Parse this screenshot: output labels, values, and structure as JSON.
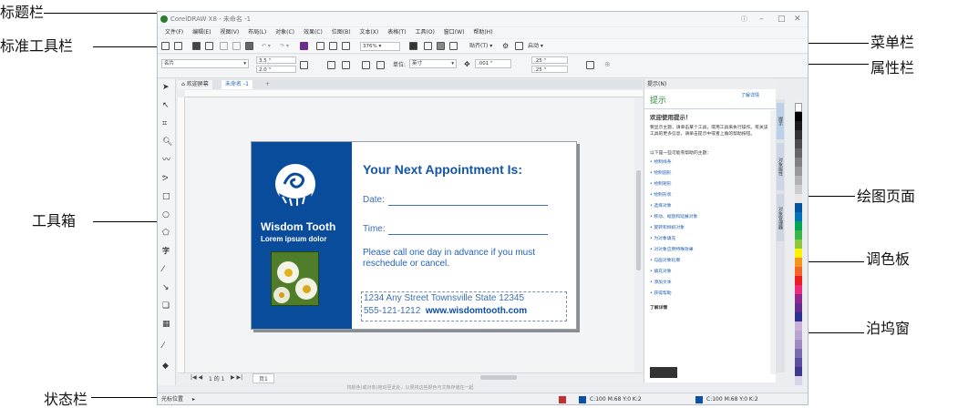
{
  "callouts": {
    "title_bar": "标题栏",
    "standard_toolbar": "标准工具栏",
    "toolbox": "工具箱",
    "status_bar": "状态栏",
    "menu_bar": "菜单栏",
    "property_bar": "属性栏",
    "drawing_page": "绘图页面",
    "color_palette": "调色板",
    "docker": "泊坞窗"
  },
  "window": {
    "title": "CorelDRAW X8 - 未命名 -1",
    "minimize": "–",
    "restore": "□",
    "close": "✕"
  },
  "menu": [
    "文件(F)",
    "编辑(E)",
    "视图(V)",
    "布局(L)",
    "对象(C)",
    "效果(C)",
    "位图(B)",
    "文本(X)",
    "表格(T)",
    "工具(O)",
    "窗口(W)",
    "帮助(H)"
  ],
  "standard_toolbar": {
    "zoom": "376%",
    "snap": "贴齐(T)",
    "launch": "启动"
  },
  "property_bar": {
    "paper": "名片",
    "width": "3.5 \"",
    "height": "2.0 \"",
    "units_label": "单位:",
    "units": "英寸",
    "nudge": ".001 \"",
    "dup_x": ".25 \"",
    "dup_y": ".25 \""
  },
  "doc_tabs": {
    "welcome": "欢迎屏幕",
    "doc": "未命名 -1",
    "add": "+"
  },
  "card": {
    "company": "Wisdom Tooth",
    "tagline": "Lorem ipsum dolor",
    "heading": "Your Next Appointment Is:",
    "date_label": "Date:",
    "time_label": "Time:",
    "message": "Please call one day in advance if you must reschedule or cancel.",
    "address": "1234 Any Street Townsville State 12345",
    "phone": "555-121-1212",
    "website": "www.wisdomtooth.com"
  },
  "page_nav": {
    "page_label": "1 的 1",
    "page_tab": "页1"
  },
  "hint": "将颜色(或对象)拖动至此处，以便将这些颜色与文档存储在一起",
  "docker": {
    "header": "提示(N)",
    "title": "提示",
    "learn": "了解详情",
    "welcome": "欢迎使用提示！",
    "intro": "要显示主题，请单击某个工具，或用工具来执行操作。有关该工具的更多信息，请单击提示中或者上角的帮助按钮。",
    "topics_intro": "以下是一些可能有帮助的主题：",
    "links": [
      "• 绘制线条",
      "• 绘制圆形",
      "• 绘制矩形",
      "• 绘制形状",
      "• 选择对象",
      "• 移动、缩放和延展对象",
      "• 旋转和倾斜对象",
      "• 为对象填充",
      "• 对对象应用特殊效果",
      "• 勾画对象轮廓",
      "• 填充对象",
      "• 添加文本",
      "• 获得帮助"
    ],
    "more": "了解详情"
  },
  "docker_tabs": [
    "提示",
    "对象属性",
    "对象管理器"
  ],
  "status": {
    "left": "光标位置",
    "fill": "C:100 M:68 Y:0 K:2",
    "outline": "C:100 M:68 Y:0 K:2"
  },
  "palette_colors": [
    "#ffffff",
    "#000000",
    "#1a1a1a",
    "#333333",
    "#4d4d4d",
    "#666666",
    "#808080",
    "#999999",
    "#b3b3b3",
    "#cccccc",
    "#e6e6e6",
    "#00539f",
    "#0072bc",
    "#00a651",
    "#39b54a",
    "#8dc63f",
    "#fff200",
    "#f7941d",
    "#f26522",
    "#ed1c24",
    "#ee2a7b",
    "#92278f",
    "#662d91",
    "#2e3192",
    "#c9b1d6",
    "#b7a4d1",
    "#9e8bc4",
    "#7a6bb0",
    "#5a4fa0",
    "#3f3a8f",
    "#d8d4ea"
  ]
}
